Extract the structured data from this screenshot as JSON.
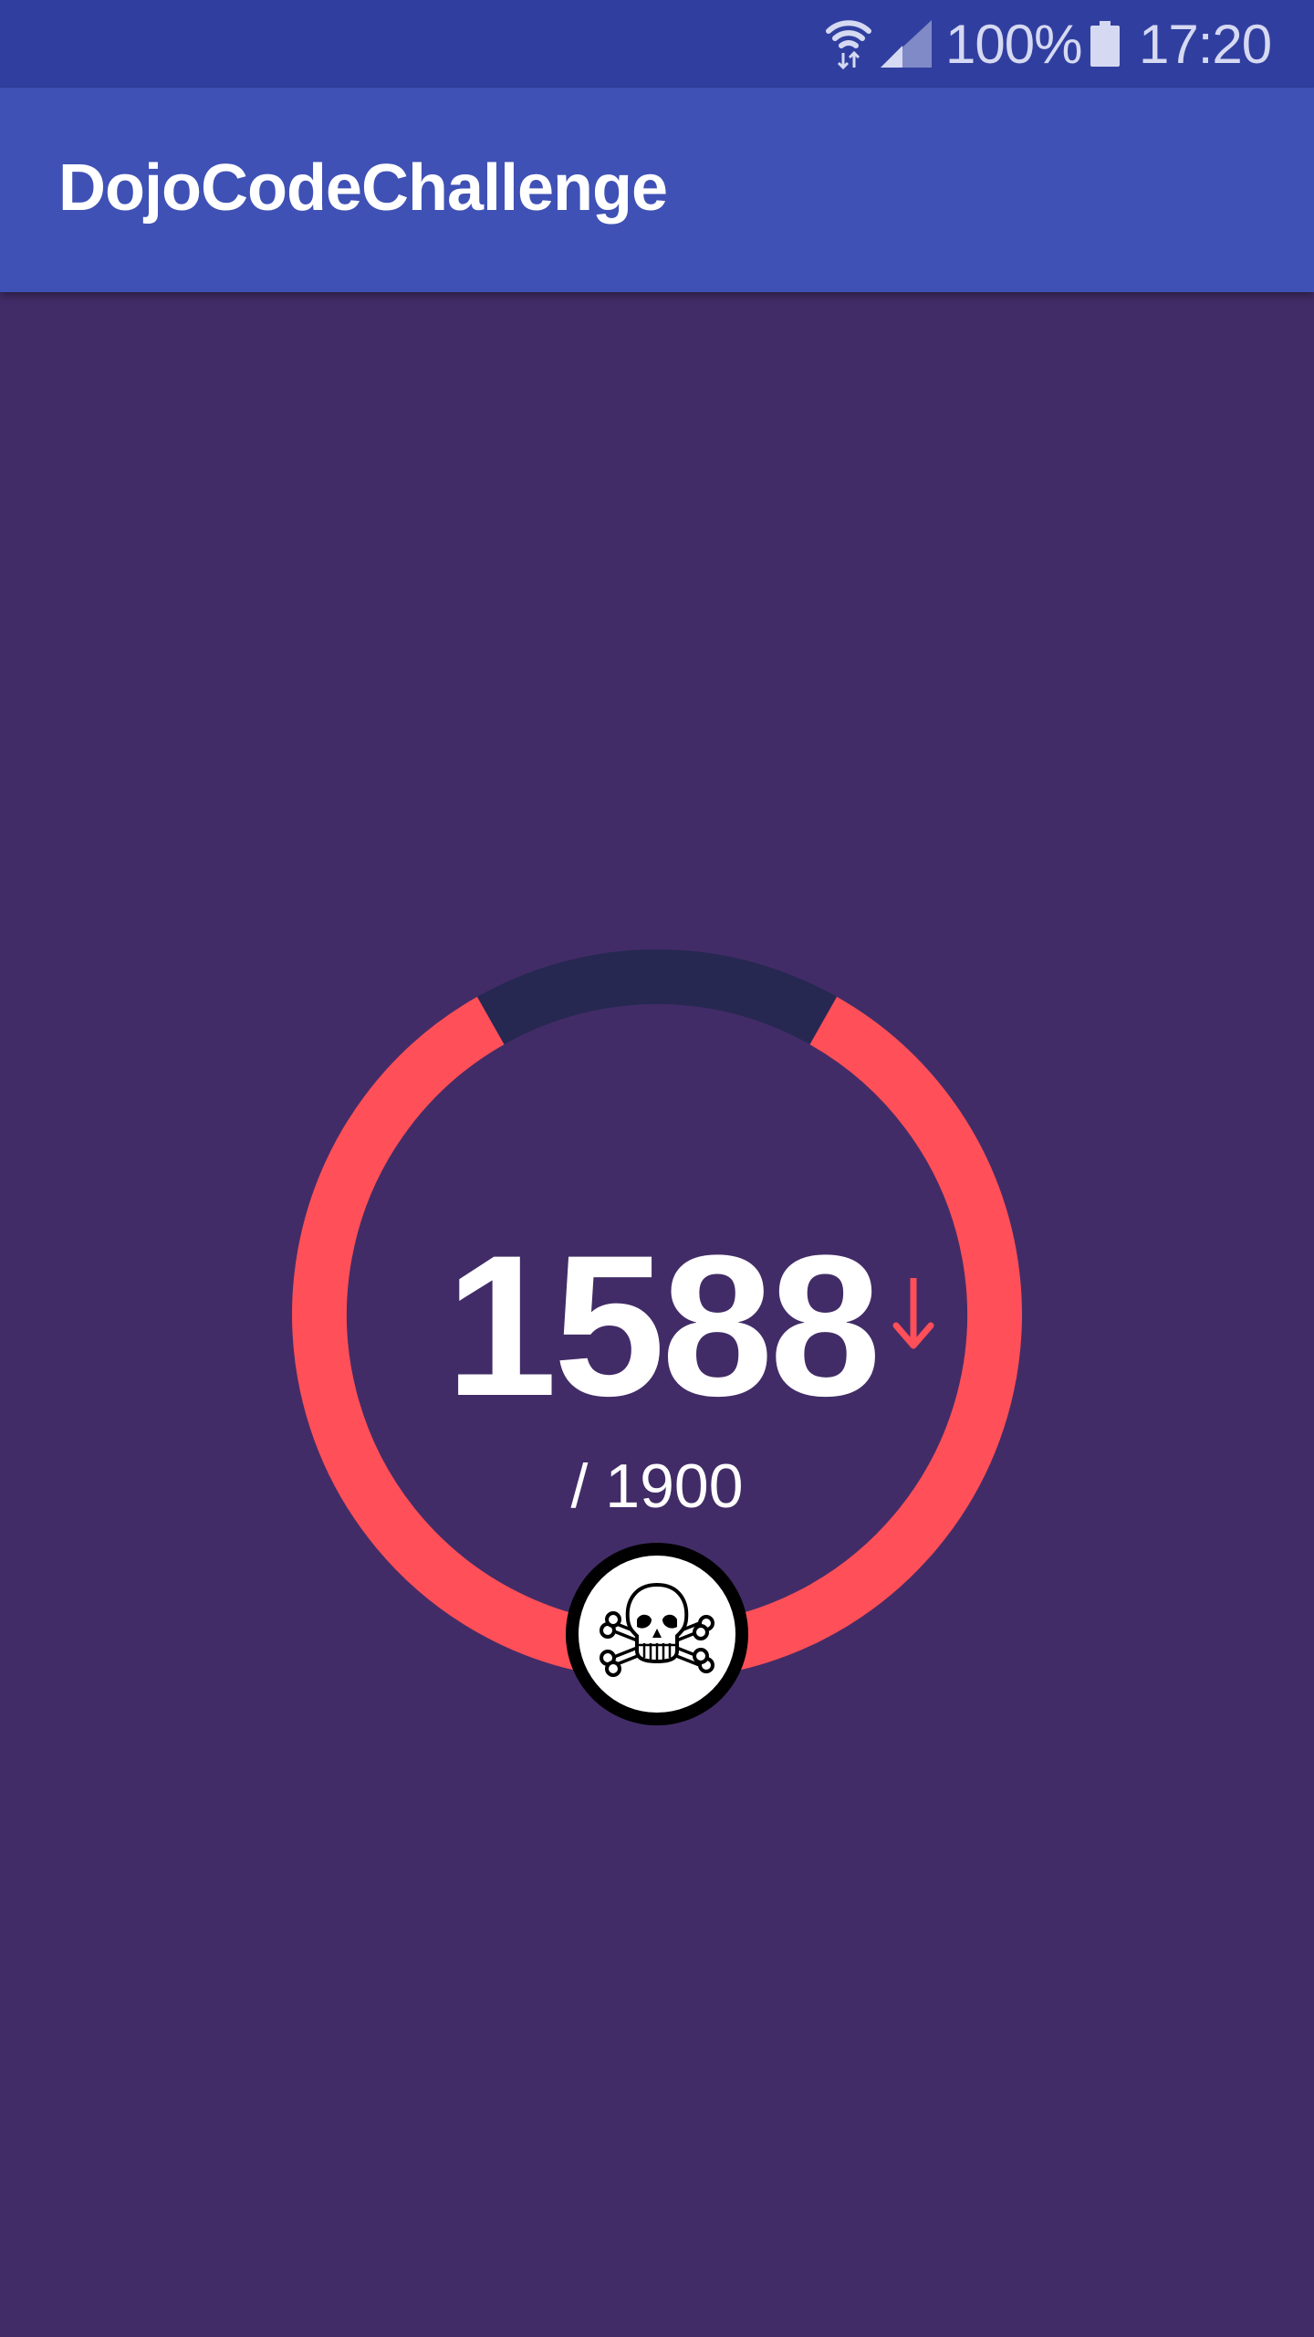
{
  "status_bar": {
    "battery_percent": "100%",
    "time": "17:20",
    "icons": [
      "wifi-icon",
      "cell-signal-icon",
      "battery-icon"
    ]
  },
  "app_bar": {
    "title": "DojoCodeChallenge"
  },
  "gauge": {
    "score": "1588",
    "target": "/ 1900",
    "progress_fraction": 0.836,
    "trend": "down",
    "trend_icon": "arrow-down-icon",
    "badge_icon": "skull-and-crossbones-icon"
  },
  "colors": {
    "status_bar": "#303f9f",
    "app_bar": "#3f51b5",
    "background": "#422c67",
    "progress": "#ff4f58",
    "track": "#262852",
    "text": "#ffffff"
  }
}
